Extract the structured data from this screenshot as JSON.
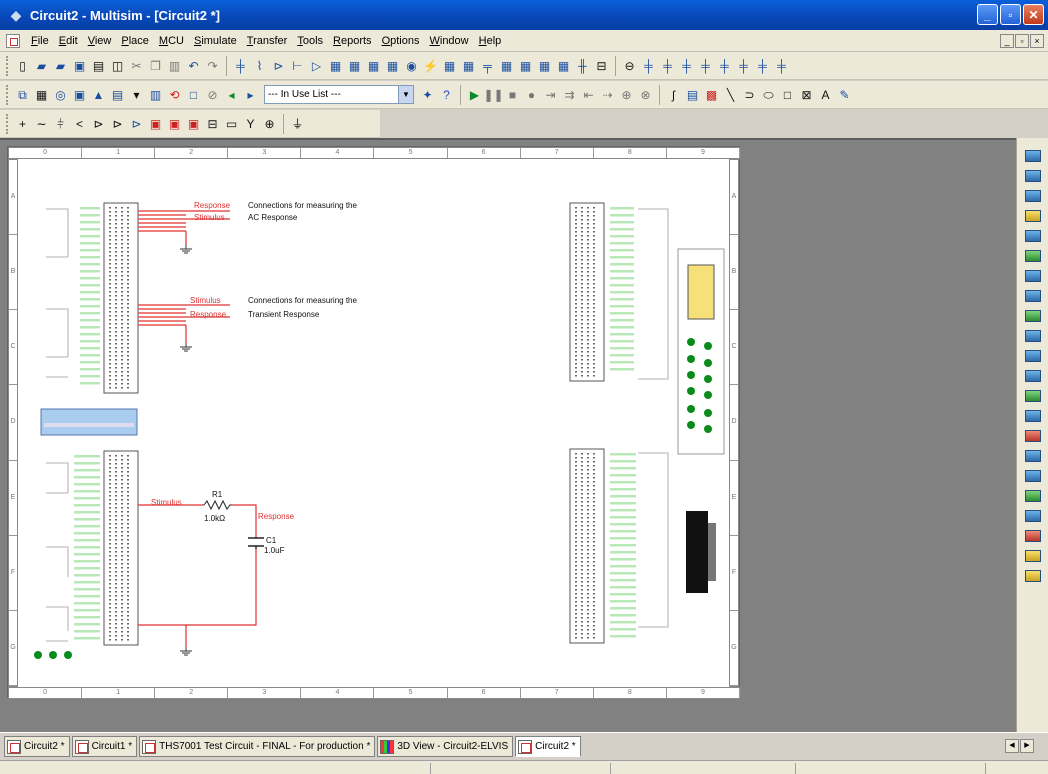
{
  "window": {
    "title": "Circuit2 - Multisim - [Circuit2 *]",
    "minimize": "_",
    "maximize": "▫",
    "close": "✕"
  },
  "menubar": {
    "items": [
      "File",
      "Edit",
      "View",
      "Place",
      "MCU",
      "Simulate",
      "Transfer",
      "Tools",
      "Reports",
      "Options",
      "Window",
      "Help"
    ],
    "mdi": [
      "_",
      "▫",
      "×"
    ]
  },
  "toolbar": {
    "in_use_list": "--- In Use List ---"
  },
  "schematic": {
    "ruler_cols": [
      "0",
      "1",
      "2",
      "3",
      "4",
      "5",
      "6",
      "7",
      "8",
      "9"
    ],
    "ruler_rows": [
      "A",
      "B",
      "C",
      "D",
      "E",
      "F",
      "G"
    ],
    "top_label_1": "Response",
    "top_label_2": "Stimulus",
    "top_note_1a": "Connections for measuring the",
    "top_note_1b": "AC Response",
    "mid_label_1": "Stimulus",
    "mid_label_2": "Response",
    "mid_note_a": "Connections for measuring the",
    "mid_note_b": "Transient Response",
    "bot_stimulus": "Stimulus",
    "bot_response": "Response",
    "r1_ref": "R1",
    "r1_value": "1.0kΩ",
    "c1_ref": "C1",
    "c1_value": "1.0uF"
  },
  "tabs": [
    {
      "label": "Circuit2 *"
    },
    {
      "label": "Circuit1 *"
    },
    {
      "label": "THS7001 Test Circuit - FINAL - For production *"
    },
    {
      "label": "3D View - Circuit2-ELVIS"
    },
    {
      "label": "Circuit2 *"
    }
  ],
  "colors": {
    "wire": "#e03030",
    "titlebar": "#0a5fd8",
    "workspace": "#818181",
    "led": "#0a8a1a"
  }
}
